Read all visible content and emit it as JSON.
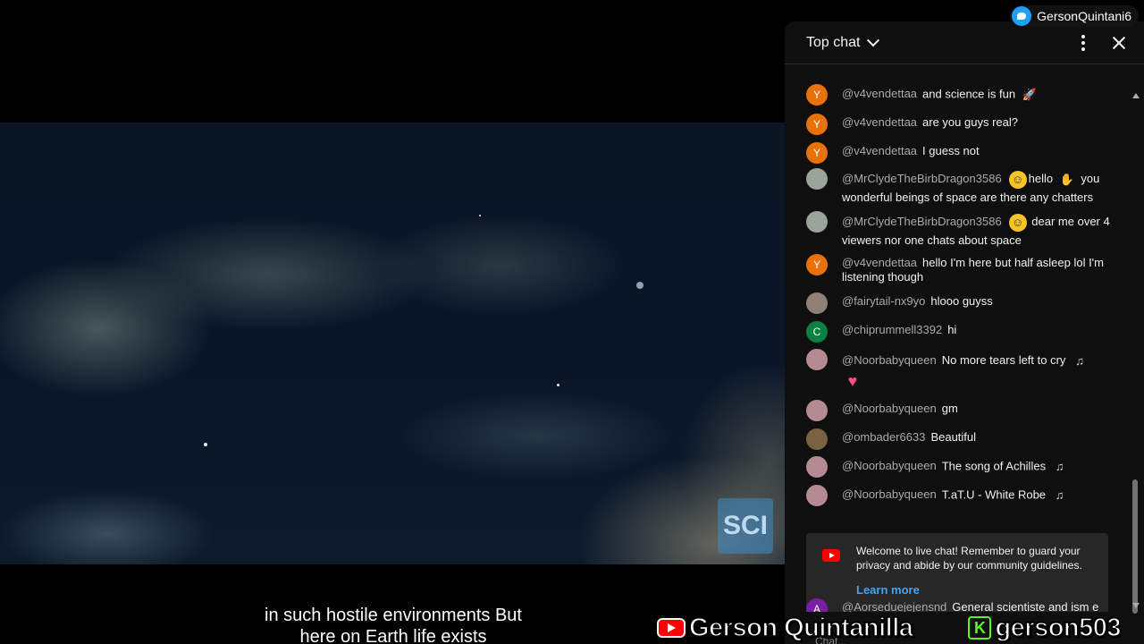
{
  "overlay": {
    "twitter_handle": "GersonQuintani6",
    "youtube_channel": "Gerson Quintanilla",
    "kick_channel": "gerson503"
  },
  "video": {
    "subtitle_line1": "in such hostile environments But",
    "subtitle_line2": "here on Earth life exists",
    "watermark": "SCI"
  },
  "chat": {
    "title": "Top chat",
    "messages": [
      {
        "initial": "Y",
        "author": "@v4vendettaa",
        "text": "and science is fun",
        "emoji": "🚀",
        "color": "#e8710a"
      },
      {
        "initial": "Y",
        "author": "@v4vendettaa",
        "text": "are you guys real?",
        "color": "#e8710a"
      },
      {
        "initial": "Y",
        "author": "@v4vendettaa",
        "text": "I guess not",
        "color": "#e8710a"
      },
      {
        "initial": "",
        "author": "@MrClydeTheBirbDragon3586",
        "text_a": "hello",
        "text_b": "you wonderful beings of space are there any chatters",
        "color": "#9aa49a"
      },
      {
        "initial": "",
        "author": "@MrClydeTheBirbDragon3586",
        "text": "dear me over 4 viewers nor one chats about space",
        "color": "#9aa49a"
      },
      {
        "initial": "Y",
        "author": "@v4vendettaa",
        "text": "hello I'm here but half asleep lol I'm listening though",
        "color": "#e8710a"
      },
      {
        "initial": "",
        "author": "@fairytail-nx9yo",
        "text": "hlooo guyss",
        "color": "#8f7f74"
      },
      {
        "initial": "C",
        "author": "@chiprummell3392",
        "text": "hi",
        "color": "#0b8043"
      },
      {
        "initial": "",
        "author": "@Noorbabyqueen",
        "text": "No more tears left to cry",
        "color": "#b58a92"
      },
      {
        "initial": "",
        "author": "@Noorbabyqueen",
        "text": "gm",
        "color": "#b58a92"
      },
      {
        "initial": "",
        "author": "@ombader6633",
        "text": "Beautiful",
        "color": "#7a6240"
      },
      {
        "initial": "",
        "author": "@Noorbabyqueen",
        "text": "The song of Achilles",
        "color": "#b58a92"
      },
      {
        "initial": "",
        "author": "@Noorbabyqueen",
        "text": "T.aT.U - White Robe",
        "color": "#b58a92"
      },
      {
        "initial": "A",
        "author": "@Aorseduejejensnd",
        "text": "General scientiste and ism e azum what is jock mazaq subject ?",
        "color": "#7b1fa2"
      }
    ],
    "welcome_text": "Welcome to live chat! Remember to guard your privacy and abide by our community guidelines.",
    "learn_more": "Learn more",
    "input_placeholder": "Chat..."
  }
}
